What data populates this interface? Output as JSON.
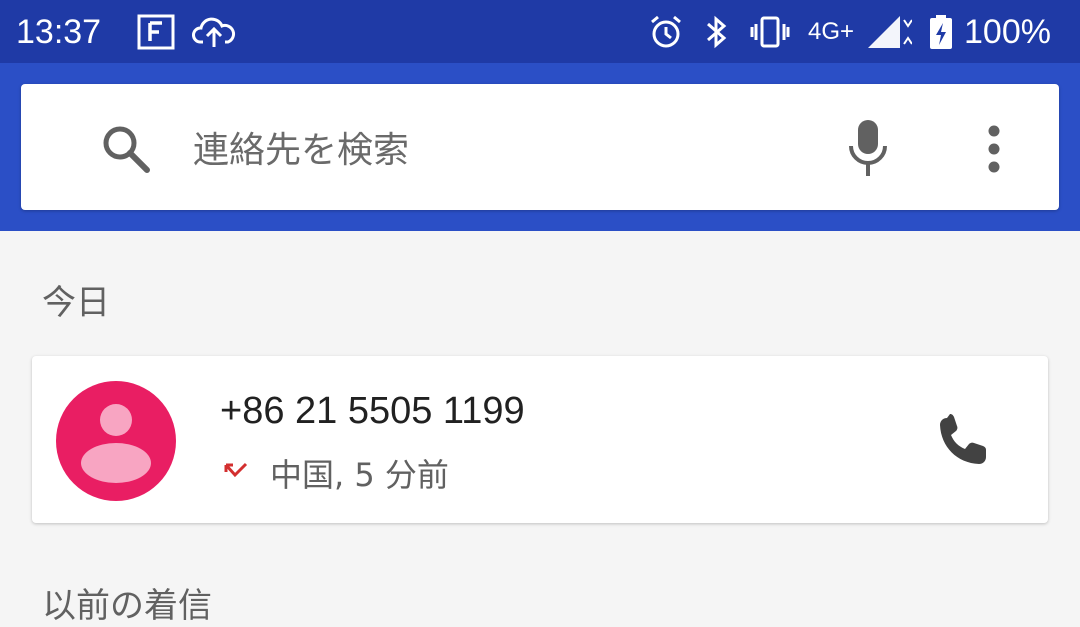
{
  "status_bar": {
    "time": "13:37",
    "network": "4G+",
    "battery": "100%",
    "icons": [
      "flipboard-icon",
      "cloud-upload-icon",
      "alarm-icon",
      "bluetooth-icon",
      "vibrate-icon",
      "signal-icon",
      "battery-charging-icon"
    ]
  },
  "search": {
    "placeholder": "連絡先を検索"
  },
  "sections": {
    "today": "今日",
    "earlier": "以前の着信"
  },
  "call": {
    "number": "+86 21 5505 1199",
    "detail": "中国, 5 分前",
    "type": "missed"
  },
  "colors": {
    "status_bar": "#1f3aa6",
    "header": "#2b4fc6",
    "avatar": "#e91e63",
    "missed": "#d32f2f"
  }
}
